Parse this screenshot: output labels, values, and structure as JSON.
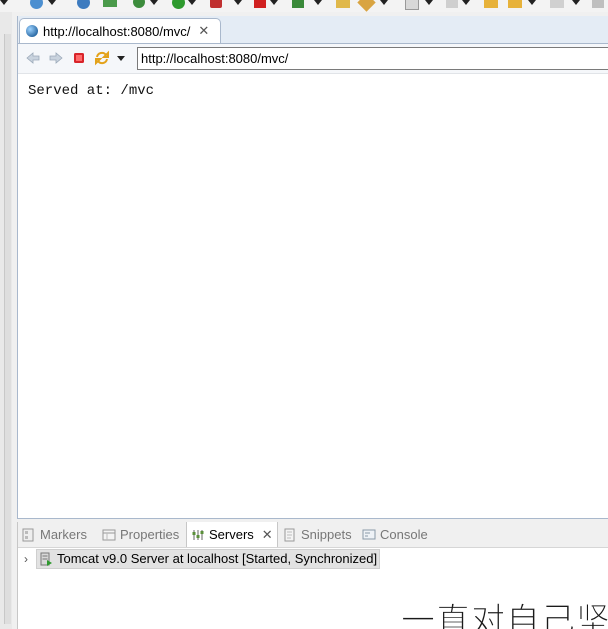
{
  "toolbar": {
    "icons": [
      "dropdown-arrow-icon",
      "spring-icon",
      "globe-icon",
      "run-external-icon",
      "debug-icon",
      "run-icon",
      "coverage-icon",
      "stop-server-icon",
      "start-server-icon",
      "open-folder-icon",
      "build-icon",
      "annotation-icon",
      "navigate-icon",
      "back-icon",
      "forward-icon"
    ]
  },
  "browser": {
    "tab_title": "http://localhost:8080/mvc/",
    "tab_close": "✕",
    "url_value": "http://localhost:8080/mvc/",
    "page_text": "Served at: /mvc"
  },
  "panel": {
    "tabs": [
      {
        "label": "Markers",
        "icon": "markers-icon",
        "active": false
      },
      {
        "label": "Properties",
        "icon": "properties-icon",
        "active": false
      },
      {
        "label": "Servers",
        "icon": "servers-icon",
        "active": true
      },
      {
        "label": "Snippets",
        "icon": "snippets-icon",
        "active": false
      },
      {
        "label": "Console",
        "icon": "console-icon",
        "active": false
      }
    ],
    "servers_close": "✕",
    "server_chevron": "›",
    "server_row": "Tomcat v9.0 Server at localhost  [Started, Synchronized]"
  },
  "watermark": "一直对自己坚"
}
